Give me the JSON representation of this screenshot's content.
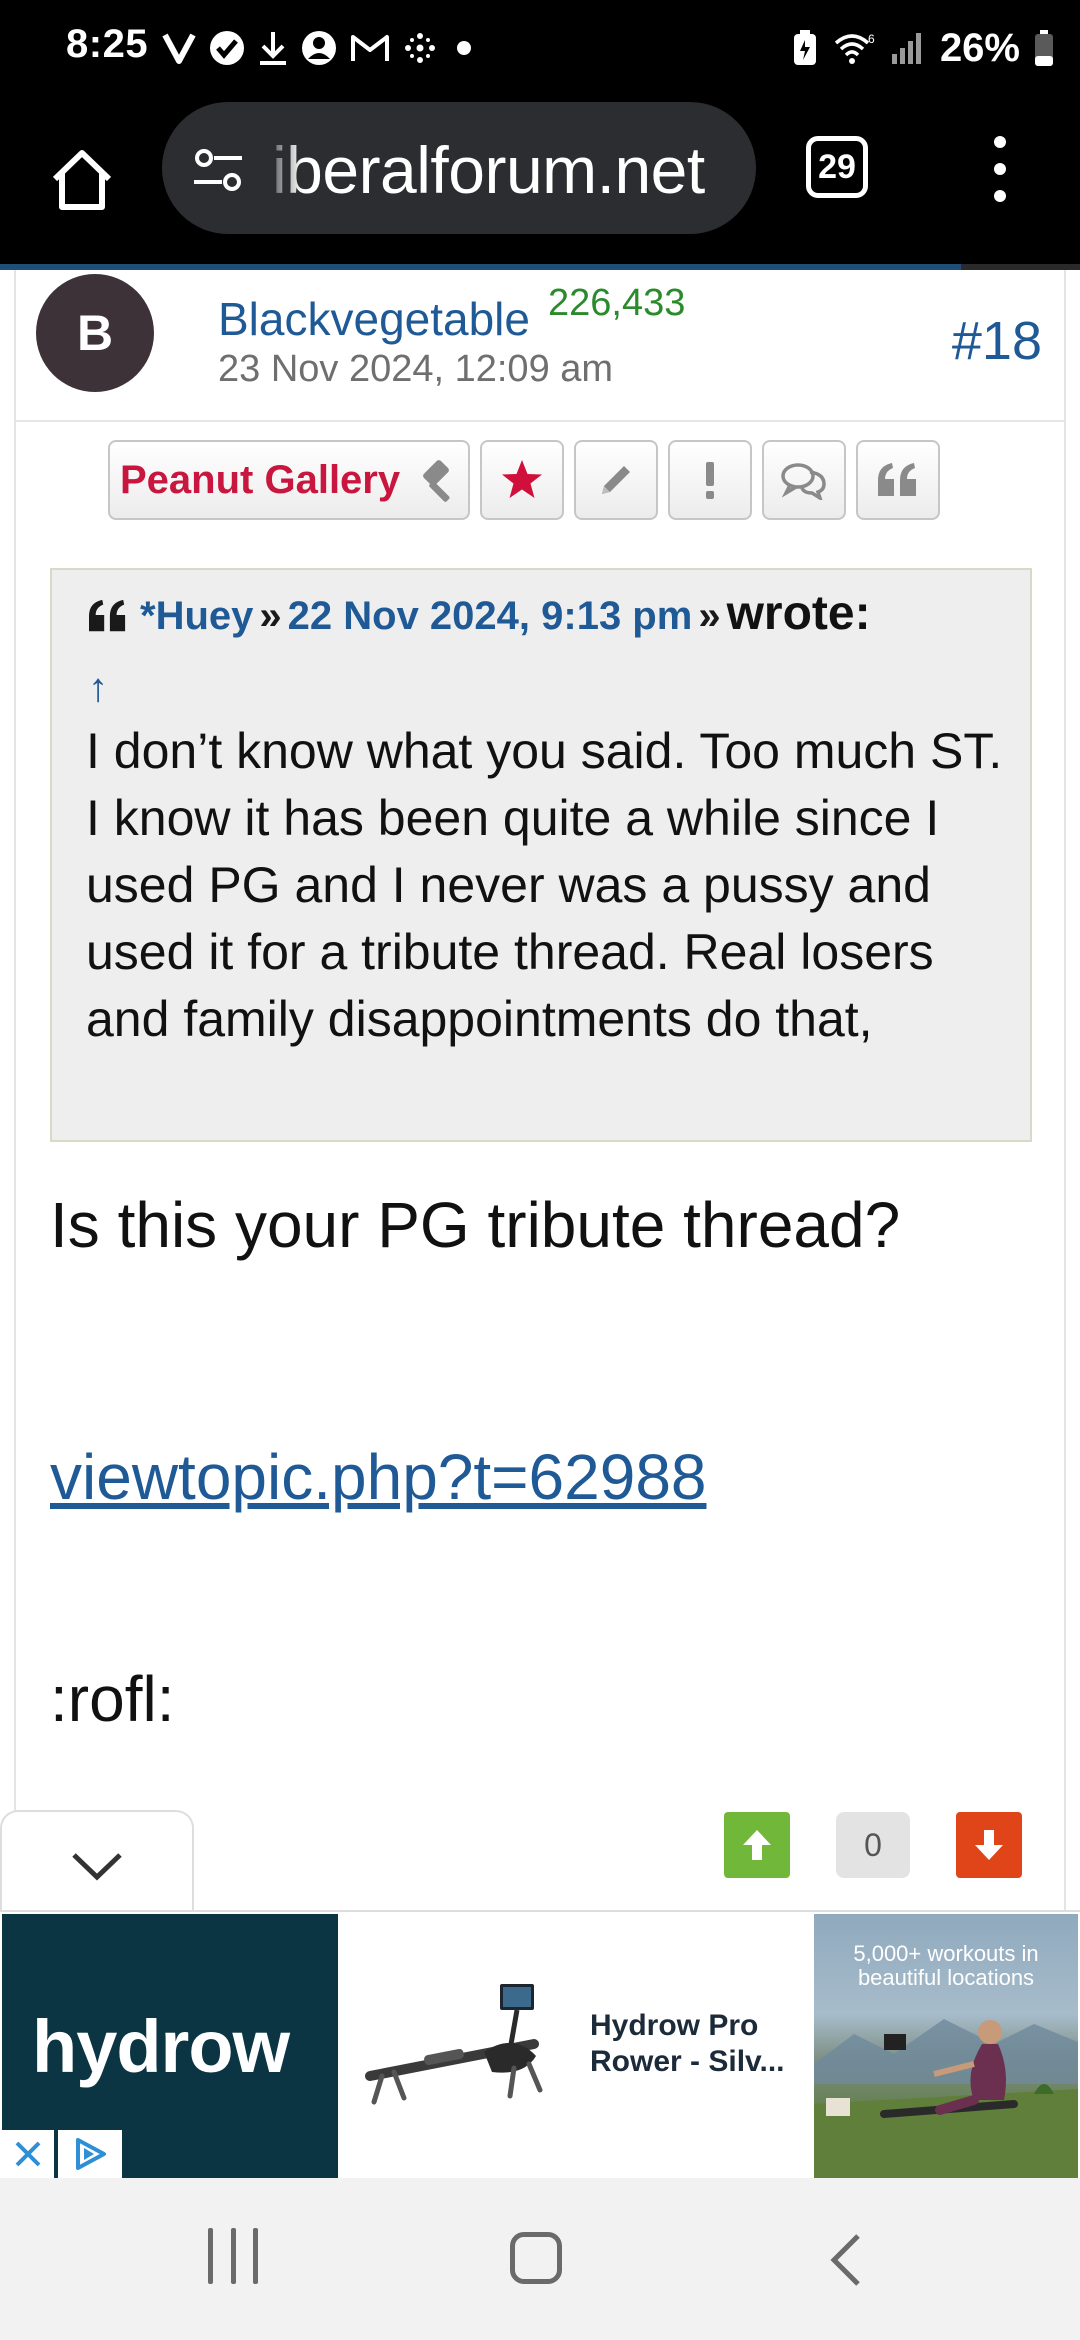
{
  "status_bar": {
    "time": "8:25",
    "battery": "26%",
    "left_icons": [
      "v-icon",
      "verified-check-icon",
      "download-icon",
      "account-circle-icon",
      "gmail-icon",
      "dots-spark-icon",
      "dot-icon"
    ],
    "right_icons": [
      "battery-saver-icon",
      "wifi-6-icon",
      "signal-icon",
      "battery-icon"
    ]
  },
  "browser": {
    "url": "iberalforum.net",
    "tab_count": "29",
    "page_load_progress": 0.89
  },
  "post": {
    "avatar_letter": "B",
    "username": "Blackvegetable",
    "post_count": "226,433",
    "date": "23 Nov 2024, 12:09 am",
    "number": "#18",
    "actions": {
      "rank_label": "Peanut Gallery",
      "icons": [
        "gavel-icon",
        "star-icon",
        "pencil-icon",
        "exclamation-icon",
        "speech-bubbles-icon",
        "quote-icon"
      ]
    },
    "quote": {
      "author": "*Huey",
      "separator": "»",
      "date": "22 Nov 2024, 9:13 pm",
      "wrote": "wrote:",
      "jump_arrow": "↑",
      "text": "I don’t know what you said.  Too much ST.  I know it has been quite a while since I used PG and I never was a pussy and used it for a tribute thread.  Real losers and family disappointments do that,"
    },
    "body_line": "Is this your PG tribute thread?",
    "link": "viewtopic.php?t=62988",
    "smiley": ":rofl:",
    "vote_count": "0"
  },
  "ad": {
    "brand": "hydrow",
    "title": "Hydrow Pro Rower - Silv...",
    "photo_caption": "5,000+ workouts in beautiful locations",
    "colors": {
      "brand_panel": "#0c3543",
      "choices": "#2f8fd6"
    }
  },
  "colors": {
    "link": "#1f5a96",
    "rank": "#c8163f",
    "post_count": "#2b8a2b",
    "vote_up": "#71b83a",
    "vote_down": "#e0451a"
  }
}
